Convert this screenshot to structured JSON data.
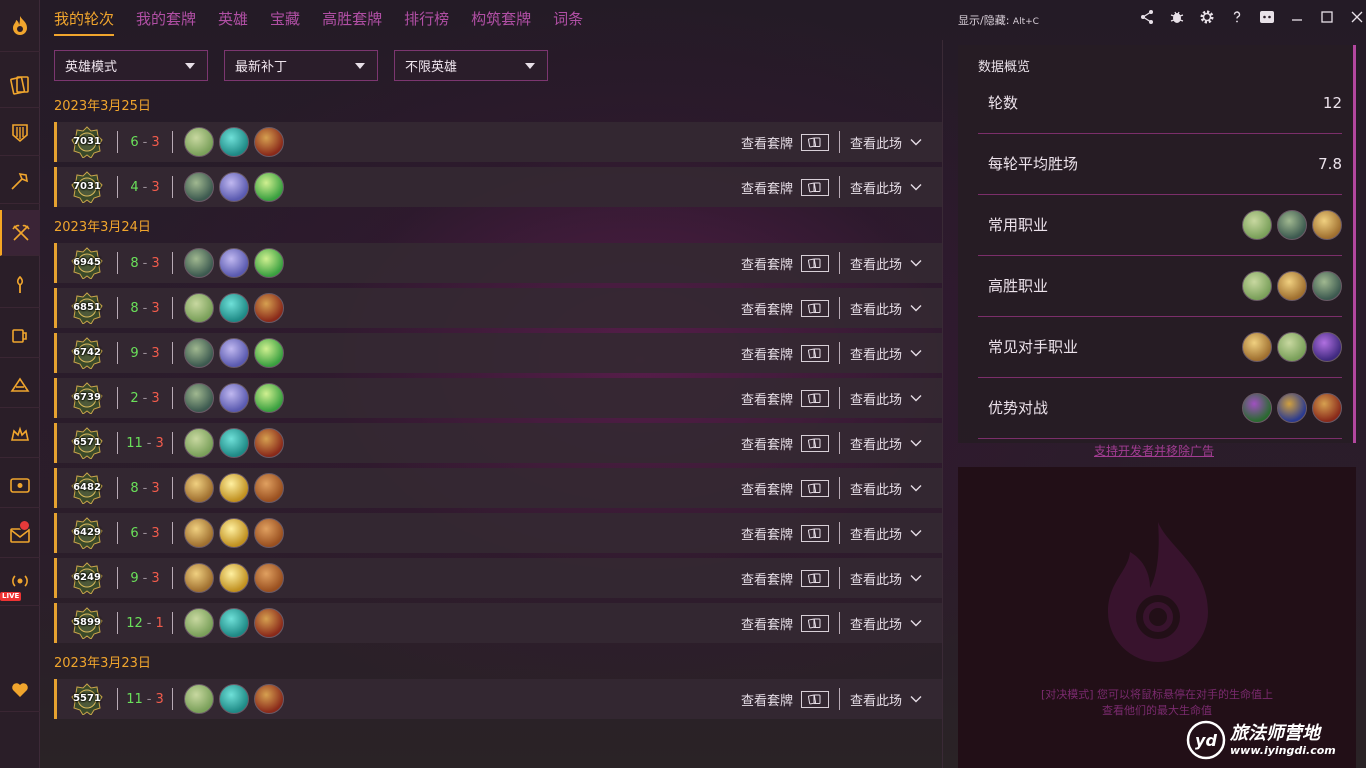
{
  "nav": {
    "tabs": [
      "我的轮次",
      "我的套牌",
      "英雄",
      "宝藏",
      "高胜套牌",
      "排行榜",
      "构筑套牌",
      "词条"
    ],
    "active_index": 0,
    "shortcut_label": "显示/隐藏:",
    "shortcut_key": "Alt+C"
  },
  "filters": {
    "mode": "英雄模式",
    "patch": "最新补丁",
    "hero": "不限英雄"
  },
  "actions": {
    "view_deck": "查看套牌",
    "view_match": "查看此场"
  },
  "groups": [
    {
      "date": "2023年3月25日",
      "runs": [
        {
          "rating": "7031",
          "wins": "6",
          "losses": "3",
          "heroes": [
            "hero-green",
            "hero-teal",
            "hero-red"
          ]
        },
        {
          "rating": "7031",
          "wins": "4",
          "losses": "3",
          "heroes": [
            "hero-green2",
            "hero-purple",
            "hero-lime"
          ]
        }
      ]
    },
    {
      "date": "2023年3月24日",
      "runs": [
        {
          "rating": "6945",
          "wins": "8",
          "losses": "3",
          "heroes": [
            "hero-green2",
            "hero-purple",
            "hero-lime"
          ]
        },
        {
          "rating": "6851",
          "wins": "8",
          "losses": "3",
          "heroes": [
            "hero-green",
            "hero-teal",
            "hero-red"
          ]
        },
        {
          "rating": "6742",
          "wins": "9",
          "losses": "3",
          "heroes": [
            "hero-green2",
            "hero-purple",
            "hero-lime"
          ]
        },
        {
          "rating": "6739",
          "wins": "2",
          "losses": "3",
          "heroes": [
            "hero-green2",
            "hero-purple",
            "hero-lime"
          ]
        },
        {
          "rating": "6571",
          "wins": "11",
          "losses": "3",
          "heroes": [
            "hero-green",
            "hero-teal",
            "hero-red"
          ]
        },
        {
          "rating": "6482",
          "wins": "8",
          "losses": "3",
          "heroes": [
            "hero-gold",
            "hero-yellow",
            "hero-orange"
          ]
        },
        {
          "rating": "6429",
          "wins": "6",
          "losses": "3",
          "heroes": [
            "hero-gold",
            "hero-yellow",
            "hero-orange"
          ]
        },
        {
          "rating": "6249",
          "wins": "9",
          "losses": "3",
          "heroes": [
            "hero-gold",
            "hero-yellow",
            "hero-orange"
          ]
        },
        {
          "rating": "5899",
          "wins": "12",
          "losses": "1",
          "heroes": [
            "hero-green",
            "hero-teal",
            "hero-red"
          ]
        }
      ]
    },
    {
      "date": "2023年3月23日",
      "runs": [
        {
          "rating": "5571",
          "wins": "11",
          "losses": "3",
          "heroes": [
            "hero-green",
            "hero-teal",
            "hero-red"
          ]
        }
      ]
    }
  ],
  "stats": {
    "title": "数据概览",
    "rounds_label": "轮数",
    "rounds_value": "12",
    "avg_wins_label": "每轮平均胜场",
    "avg_wins_value": "7.8",
    "common_class_label": "常用职业",
    "common_class_heroes": [
      "hero-green",
      "hero-green2",
      "hero-gold"
    ],
    "win_class_label": "高胜职业",
    "win_class_heroes": [
      "hero-green",
      "hero-gold",
      "hero-green2"
    ],
    "opponent_class_label": "常见对手职业",
    "opponent_class_heroes": [
      "hero-gold",
      "hero-green",
      "hero-violet"
    ],
    "matchup_label": "优势对战",
    "matchup_heroes": [
      "hero-forest",
      "hero-blue",
      "hero-red"
    ]
  },
  "support_link": "支持开发者并移除广告",
  "ad_tip": {
    "line1": "[对决模式] 您可以将鼠标悬停在对手的生命值上",
    "line2": "查看他们的最大生命值"
  },
  "watermark": {
    "title": "旅法师营地",
    "url": "www.iyingdi.com"
  },
  "colors": {
    "accent": "#f0a52d",
    "nav_inactive": "#b04fa4",
    "win": "#6ae05a",
    "loss": "#f25c4c",
    "panel_border": "#b3479f"
  },
  "hero_palette": {
    "hero-green": [
      "#7aa05a",
      "#c8d8a0"
    ],
    "hero-teal": [
      "#1f8a86",
      "#6fe0d8"
    ],
    "hero-red": [
      "#8a2a1a",
      "#d6a050"
    ],
    "hero-green2": [
      "#3d5a50",
      "#a0b890"
    ],
    "hero-purple": [
      "#5a5ab0",
      "#c0b8f0"
    ],
    "hero-lime": [
      "#3aa040",
      "#d0f090"
    ],
    "hero-gold": [
      "#a07030",
      "#f0d080"
    ],
    "hero-yellow": [
      "#c09020",
      "#fff0a0"
    ],
    "hero-orange": [
      "#9a5020",
      "#e0a060"
    ],
    "hero-violet": [
      "#402a80",
      "#b070e0"
    ],
    "hero-forest": [
      "#2a6a30",
      "#a050c0"
    ],
    "hero-blue": [
      "#2a3a90",
      "#d0a040"
    ]
  }
}
